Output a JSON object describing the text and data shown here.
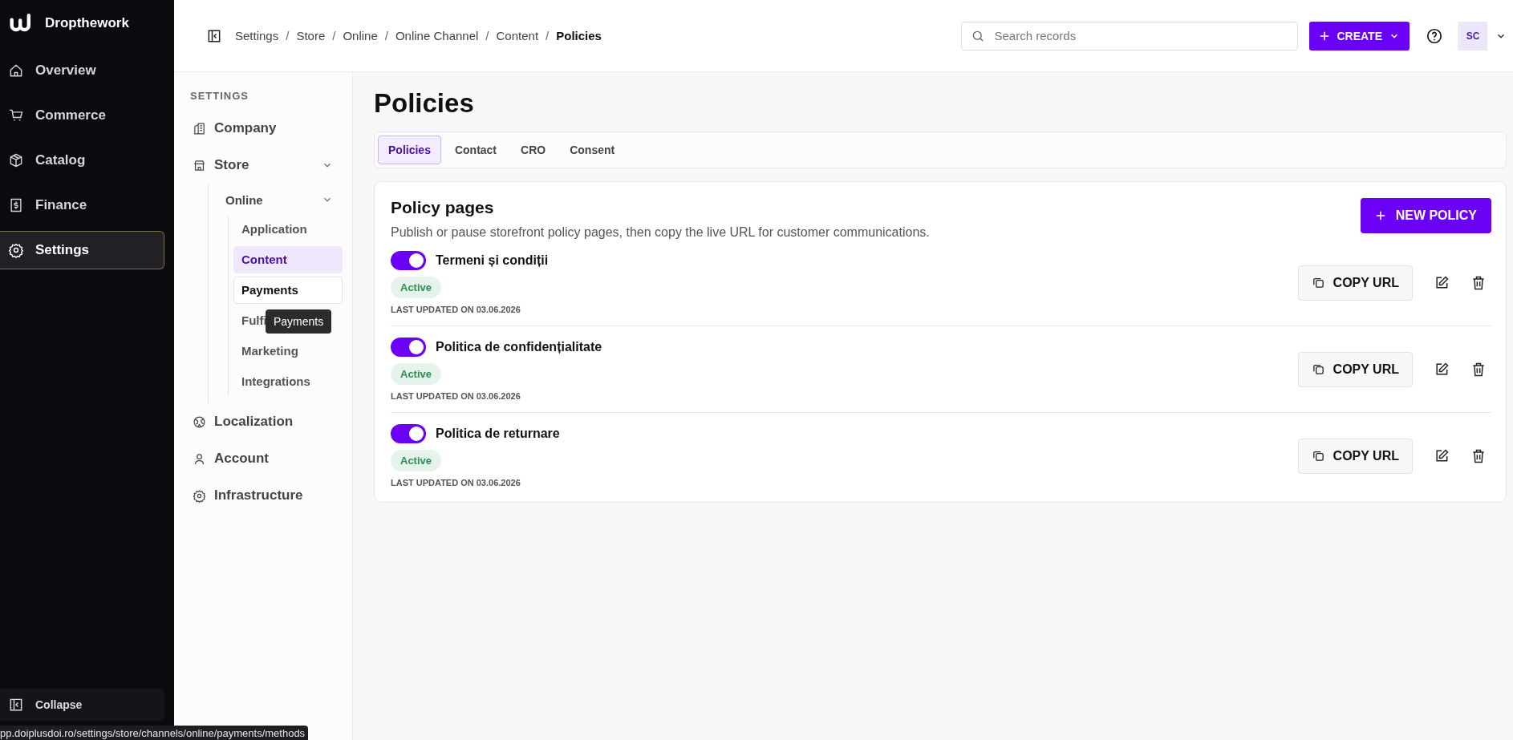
{
  "app": {
    "name": "Dropthework"
  },
  "nav": [
    {
      "label": "Overview",
      "kind": "home",
      "selected": false
    },
    {
      "label": "Commerce",
      "kind": "cart",
      "selected": false
    },
    {
      "label": "Catalog",
      "kind": "box",
      "selected": false
    },
    {
      "label": "Finance",
      "kind": "dollar",
      "selected": false
    },
    {
      "label": "Settings",
      "kind": "gear",
      "selected": true
    }
  ],
  "collapse": {
    "label": "Collapse"
  },
  "status_url": "pp.doiplusdoi.ro/settings/store/channels/online/payments/methods",
  "topbar": {
    "breadcrumbs": [
      {
        "label": "Settings"
      },
      {
        "separator": "/",
        "label": "Store"
      },
      {
        "separator": "/",
        "label": "Online"
      },
      {
        "separator": "/",
        "label": "Online Channel"
      },
      {
        "separator": "/",
        "label": "Content"
      },
      {
        "separator": "/",
        "label": "Policies"
      }
    ],
    "search": {
      "placeholder": "Search records"
    },
    "create": "CREATE",
    "avatar": "SC"
  },
  "settings": {
    "heading": "SETTINGS",
    "items": [
      {
        "label": "Company",
        "kind": "building"
      },
      {
        "label": "Store",
        "kind": "store",
        "expanded": true,
        "children": [
          {
            "label": "Online",
            "expanded": true,
            "children": [
              {
                "label": "Application",
                "selected": false,
                "hovered": false
              },
              {
                "label": "Content",
                "selected": true,
                "hovered": false
              },
              {
                "label": "Payments",
                "selected": false,
                "hovered": true
              },
              {
                "label": "Fulfi",
                "selected": false,
                "hovered": false
              },
              {
                "label": "Marketing",
                "selected": false,
                "hovered": false
              },
              {
                "label": "Integrations",
                "selected": false,
                "hovered": false
              }
            ]
          }
        ]
      },
      {
        "label": "Localization",
        "kind": "globe"
      },
      {
        "label": "Account",
        "kind": "user"
      },
      {
        "label": "Infrastructure",
        "kind": "gear"
      }
    ]
  },
  "tooltip": "Payments",
  "page": {
    "title": "Policies",
    "tabs": [
      {
        "label": "Policies",
        "selected": true
      },
      {
        "label": "Contact",
        "selected": false
      },
      {
        "label": "CRO",
        "selected": false
      },
      {
        "label": "Consent",
        "selected": false
      }
    ],
    "card": {
      "title": "Policy pages",
      "description": "Publish or pause storefront policy pages, then copy the live URL for customer communications.",
      "new_button": "NEW POLICY",
      "policies": [
        {
          "name": "Termeni și condiții",
          "on": true,
          "status": "Active",
          "updated": "LAST UPDATED ON 03.06.2026",
          "copy": "COPY URL"
        },
        {
          "name": "Politica de confidențialitate",
          "on": true,
          "status": "Active",
          "updated": "LAST UPDATED ON 03.06.2026",
          "copy": "COPY URL"
        },
        {
          "name": "Politica de returnare",
          "on": true,
          "status": "Active",
          "updated": "LAST UPDATED ON 03.06.2026",
          "copy": "COPY URL"
        }
      ]
    }
  }
}
